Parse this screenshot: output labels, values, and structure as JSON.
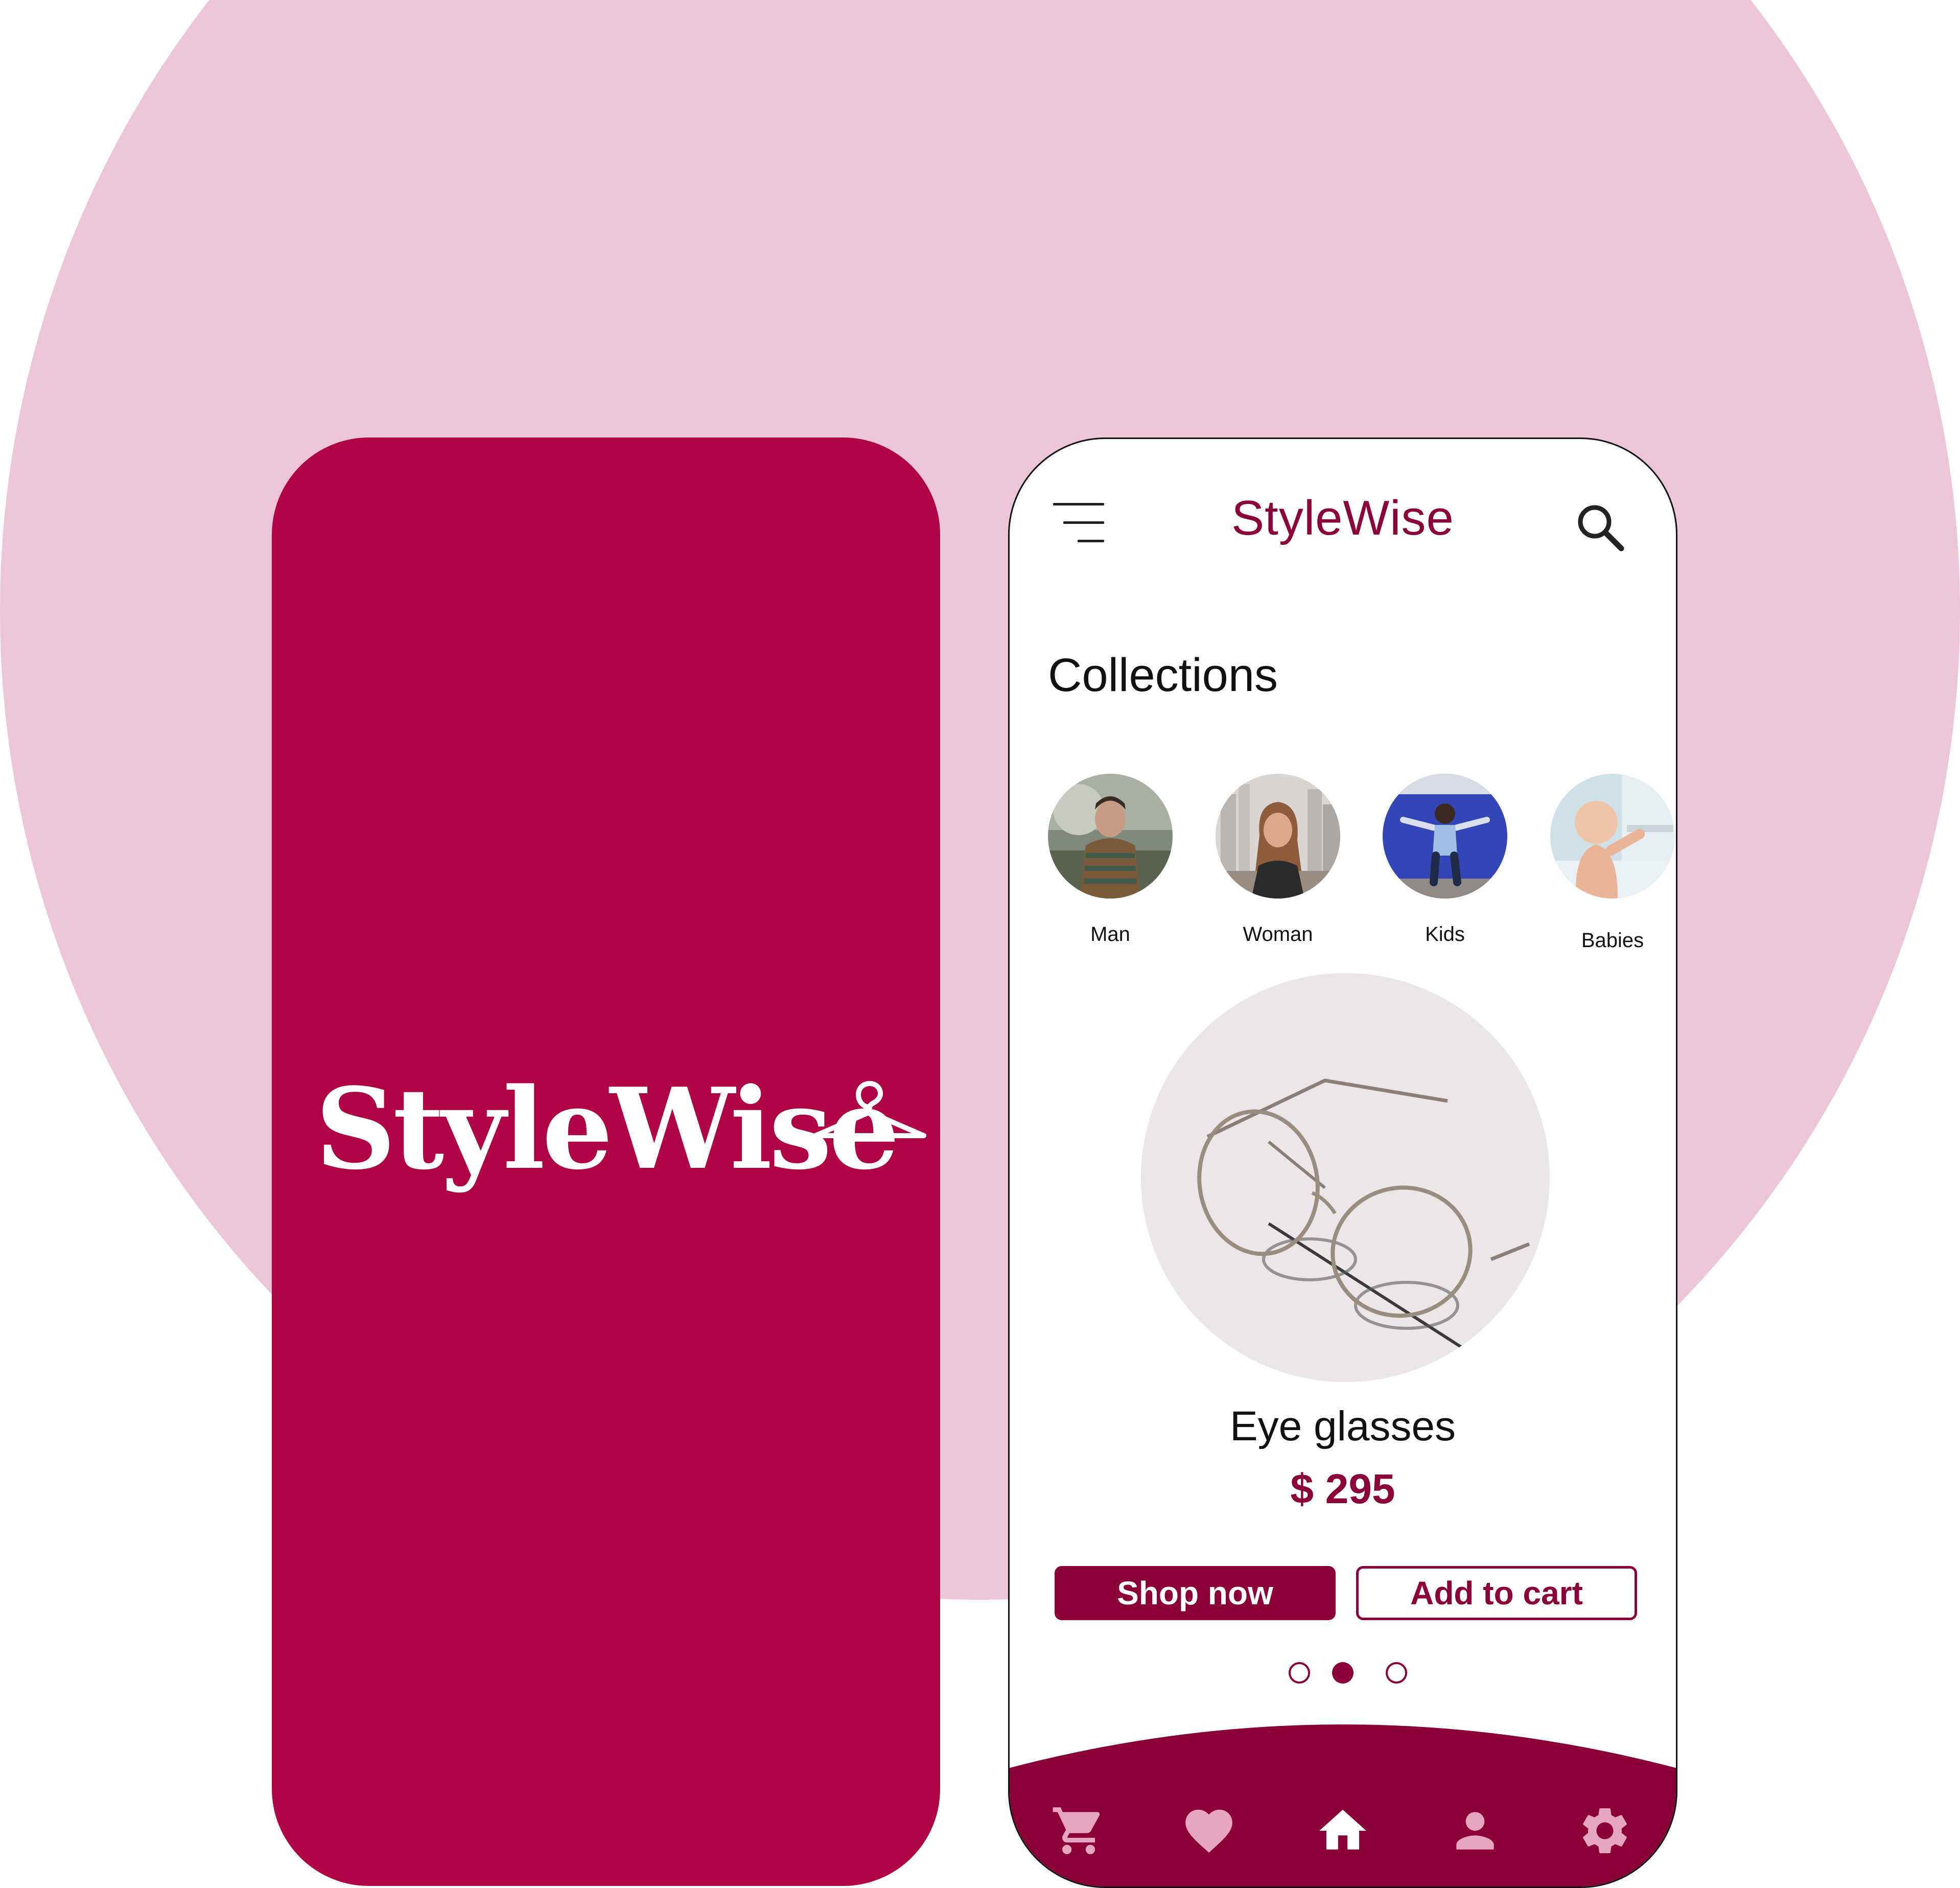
{
  "theme": {
    "brand": "#b00346",
    "accent": "#8b0038",
    "bg_circle": "#ecc6d6"
  },
  "splash": {
    "logo_text": "StyleWise",
    "logo_icon": "hanger-icon"
  },
  "header": {
    "title": "StyleWise",
    "menu_icon": "menu-icon",
    "search_icon": "search-icon"
  },
  "collections": {
    "title": "Collections",
    "items": [
      {
        "label": "Man"
      },
      {
        "label": "Woman"
      },
      {
        "label": "Kids"
      },
      {
        "label": "Babies"
      }
    ]
  },
  "product": {
    "name": "Eye glasses",
    "price": "$ 295",
    "image": "eyeglasses-photo"
  },
  "actions": {
    "shop_now": "Shop now",
    "add_to_cart": "Add to cart"
  },
  "carousel": {
    "count": 3,
    "active_index": 1
  },
  "bottom_nav": {
    "items": [
      {
        "icon": "cart-icon",
        "active": false
      },
      {
        "icon": "heart-icon",
        "active": false
      },
      {
        "icon": "home-icon",
        "active": true
      },
      {
        "icon": "user-icon",
        "active": false
      },
      {
        "icon": "gear-icon",
        "active": false
      }
    ]
  }
}
